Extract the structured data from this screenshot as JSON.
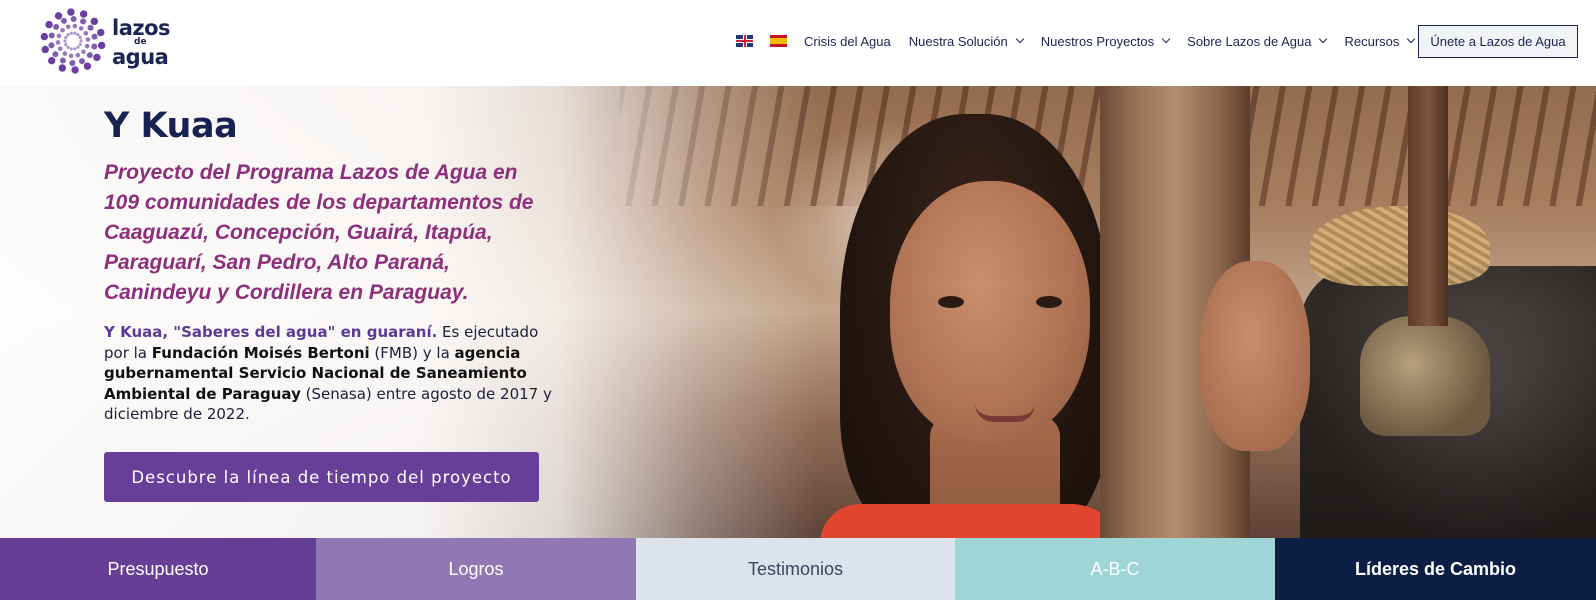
{
  "header": {
    "logo": {
      "line1": "lazos",
      "line2": "de",
      "line3": "agua",
      "icon": "flower-dots-logo-icon",
      "color": "#6a3fa0"
    },
    "flags": [
      {
        "name": "uk-flag-icon"
      },
      {
        "name": "spain-flag-icon"
      }
    ],
    "nav": [
      {
        "label": "Crisis del Agua",
        "dropdown": false
      },
      {
        "label": "Nuestra Solución",
        "dropdown": true
      },
      {
        "label": "Nuestros Proyectos",
        "dropdown": true
      },
      {
        "label": "Sobre Lazos de Agua",
        "dropdown": true
      },
      {
        "label": "Recursos",
        "dropdown": true
      }
    ],
    "cta_label": "Únete a Lazos de Agua"
  },
  "hero": {
    "title": "Y Kuaa",
    "subtitle": "Proyecto del Programa Lazos de Agua en 109 comunidades de los departamentos de Caaguazú, Concepción, Guairá, Itapúa, Paraguarí, San Pedro, Alto Paraná, Canindeyu y Cordillera en Paraguay.",
    "body": {
      "highlight": "Y Kuaa, \"Saberes del agua\" en guaraní.",
      "t1": " Es ejecutado por la ",
      "b1": "Fundación Moisés Bertoni",
      "t2": " (FMB) y la ",
      "b2": "agencia gubernamental Servicio Nacional de Saneamiento Ambiental de Paraguay",
      "t3": " (Senasa) entre agosto de 2017 y diciembre de 2022."
    },
    "button_label": "Descubre la línea de tiempo del proyecto"
  },
  "tabs": [
    {
      "label": "Presupuesto",
      "color": "#663e95"
    },
    {
      "label": "Logros",
      "color": "#9278b2"
    },
    {
      "label": "Testimonios",
      "color": "#dde3ec"
    },
    {
      "label": "A-B-C",
      "color": "#9ed5d6"
    },
    {
      "label": "Líderes de Cambio",
      "color": "#0d1e45"
    }
  ]
}
